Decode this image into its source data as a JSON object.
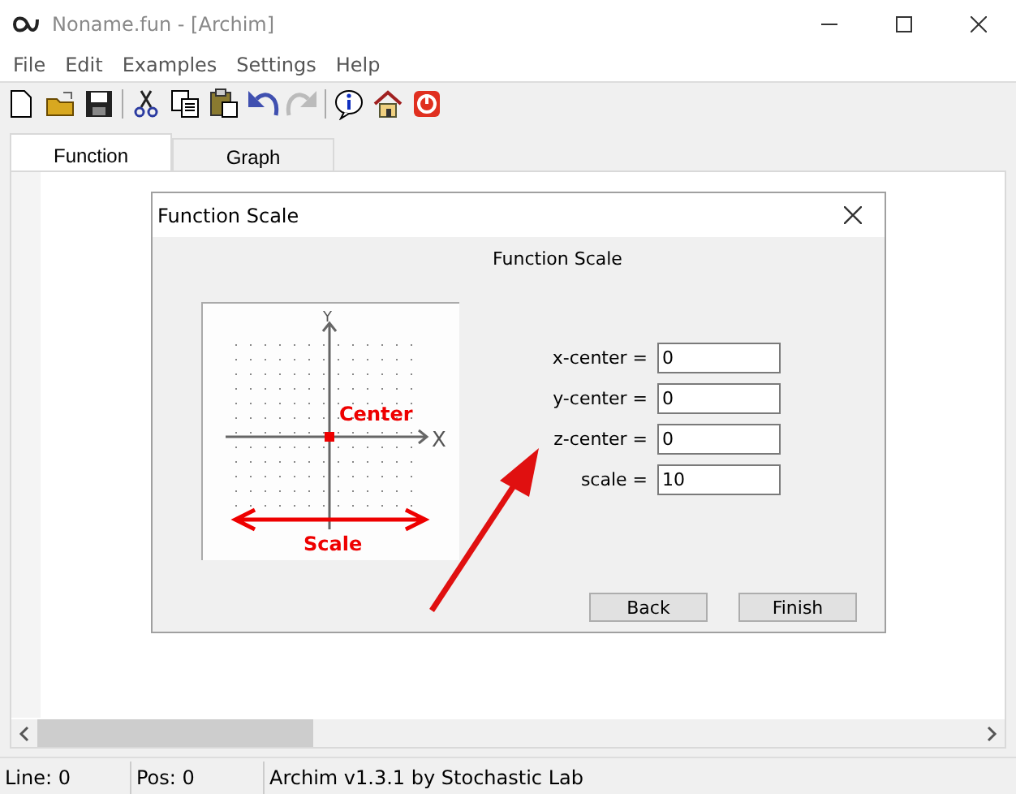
{
  "window": {
    "title": "Noname.fun - [Archim]"
  },
  "menu": [
    "File",
    "Edit",
    "Examples",
    "Settings",
    "Help"
  ],
  "toolbar": [
    {
      "kind": "new"
    },
    {
      "kind": "open"
    },
    {
      "kind": "save"
    },
    {
      "kind": "sep"
    },
    {
      "kind": "cut"
    },
    {
      "kind": "copy"
    },
    {
      "kind": "paste"
    },
    {
      "kind": "undo",
      "disabled": false
    },
    {
      "kind": "redo",
      "disabled": true
    },
    {
      "kind": "sep"
    },
    {
      "kind": "info"
    },
    {
      "kind": "home"
    },
    {
      "kind": "power"
    }
  ],
  "tabs": [
    {
      "label": "Function",
      "selected": true
    },
    {
      "label": "Graph",
      "selected": false
    }
  ],
  "dialog": {
    "title": "Function Scale",
    "heading": "Function Scale",
    "illustration": {
      "x_axis": "X",
      "y_axis": "Y",
      "center": "Center",
      "scale": "Scale"
    },
    "fields": [
      {
        "label": "x-center =",
        "value": "0"
      },
      {
        "label": "y-center =",
        "value": "0"
      },
      {
        "label": "z-center =",
        "value": "0"
      },
      {
        "label": "scale =",
        "value": "10"
      }
    ],
    "buttons": [
      "Back",
      "Finish"
    ]
  },
  "status_bar": [
    "Line: 0",
    "Pos: 0",
    "Archim v1.3.1 by Stochastic Lab"
  ]
}
